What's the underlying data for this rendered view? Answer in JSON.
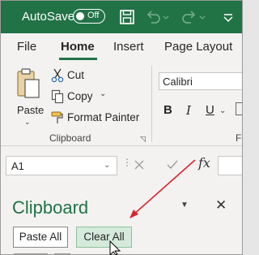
{
  "titlebar": {
    "autosave_label": "AutoSave",
    "toggle_state": "Off",
    "bg_color": "#217346",
    "icons": [
      "save-icon",
      "undo-icon",
      "redo-icon",
      "customize-chevron-icon"
    ]
  },
  "tabs": [
    {
      "label": "File",
      "active": false
    },
    {
      "label": "Home",
      "active": true
    },
    {
      "label": "Insert",
      "active": false
    },
    {
      "label": "Page Layout",
      "active": false
    }
  ],
  "ribbon": {
    "clipboard": {
      "paste_label": "Paste",
      "cut_label": "Cut",
      "copy_label": "Copy",
      "format_painter_label": "Format Painter",
      "group_label": "Clipboard"
    },
    "font": {
      "font_name": "Calibri",
      "bold": "B",
      "italic": "I",
      "underline": "U",
      "group_label_partial": "F"
    }
  },
  "formula_bar": {
    "name_box": "A1",
    "fx": "fx"
  },
  "clipboard_pane": {
    "title": "Clipboard",
    "paste_all_label": "Paste All",
    "clear_all_label": "Clear All"
  },
  "colors": {
    "accent": "#217346",
    "arrow": "#d9242b"
  }
}
